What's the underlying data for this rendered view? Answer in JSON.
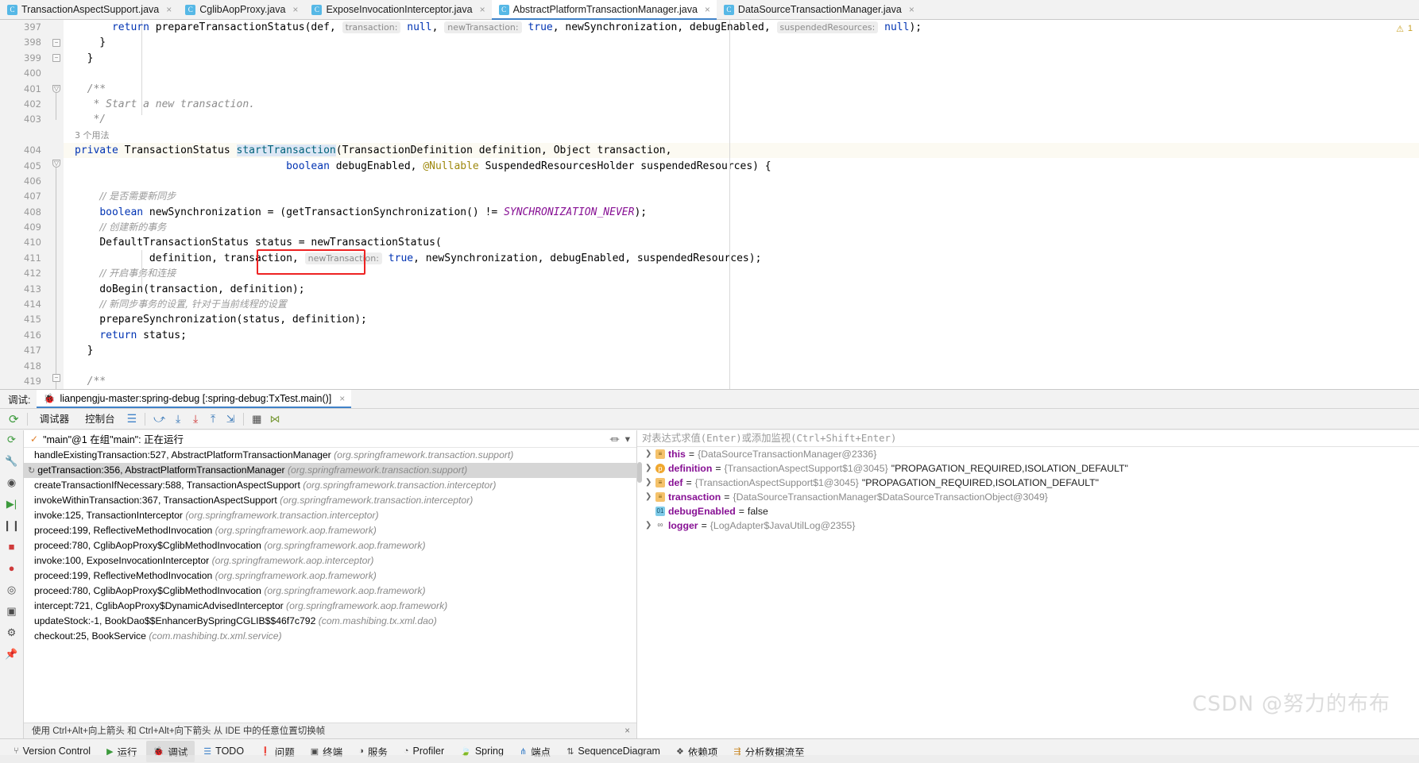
{
  "editor_tabs": [
    {
      "label": "TransactionAspectSupport.java",
      "icon": "java-class-icon",
      "active": false,
      "closable": true
    },
    {
      "label": "CglibAopProxy.java",
      "icon": "java-class-icon",
      "active": false,
      "closable": true
    },
    {
      "label": "ExposeInvocationInterceptor.java",
      "icon": "java-class-icon",
      "active": false,
      "closable": true
    },
    {
      "label": "AbstractPlatformTransactionManager.java",
      "icon": "java-class-icon",
      "active": true,
      "closable": true
    },
    {
      "label": "DataSourceTransactionManager.java",
      "icon": "java-class-icon",
      "active": false,
      "closable": true
    }
  ],
  "editor": {
    "line_numbers": [
      "397",
      "398",
      "399",
      "400",
      "401",
      "402",
      "403",
      "404",
      "405",
      "406",
      "407",
      "408",
      "409",
      "410",
      "411",
      "412",
      "413",
      "414",
      "415",
      "416",
      "417",
      "418",
      "419"
    ],
    "usage_hint": "3 个用法",
    "warning_marker": "1",
    "code_lines": [
      {
        "n": "397",
        "text": "            return prepareTransactionStatus(def,  transaction: null,  newTransaction: true, newSynchronization, debugEnabled,  suspendedResources: null);"
      },
      {
        "n": "398",
        "text": "        }"
      },
      {
        "n": "399",
        "text": "    }"
      },
      {
        "n": "400",
        "text": ""
      },
      {
        "n": "401",
        "text": "    /**"
      },
      {
        "n": "402",
        "text": "     * Start a new transaction."
      },
      {
        "n": "403",
        "text": "     */"
      },
      {
        "n": "404",
        "text": "    private TransactionStatus startTransaction(TransactionDefinition definition, Object transaction,"
      },
      {
        "n": "405",
        "text": "            boolean debugEnabled, @Nullable SuspendedResourcesHolder suspendedResources) {"
      },
      {
        "n": "406",
        "text": ""
      },
      {
        "n": "407",
        "text": "        // 是否需要新同步"
      },
      {
        "n": "408",
        "text": "        boolean newSynchronization = (getTransactionSynchronization() != SYNCHRONIZATION_NEVER);"
      },
      {
        "n": "409",
        "text": "        // 创建新的事务"
      },
      {
        "n": "410",
        "text": "        DefaultTransactionStatus status = newTransactionStatus("
      },
      {
        "n": "411",
        "text": "                definition, transaction,  newTransaction: true, newSynchronization, debugEnabled, suspendedResources);"
      },
      {
        "n": "412",
        "text": "        // 开启事务和连接"
      },
      {
        "n": "413",
        "text": "        doBegin(transaction, definition);"
      },
      {
        "n": "414",
        "text": "        // 新同步事务的设置, 针对于当前线程的设置"
      },
      {
        "n": "415",
        "text": "        prepareSynchronization(status, definition);"
      },
      {
        "n": "416",
        "text": "        return status;"
      },
      {
        "n": "417",
        "text": "    }"
      },
      {
        "n": "418",
        "text": ""
      },
      {
        "n": "419",
        "text": "    /**"
      }
    ],
    "tokens": {
      "kw_return": "return",
      "kw_private": "private",
      "kw_boolean": "boolean",
      "method_prepareTransactionStatus": "prepareTransactionStatus",
      "method_startTransaction": "startTransaction",
      "type_TransactionStatus": "TransactionStatus",
      "type_TransactionDefinition": "TransactionDefinition",
      "type_Object": "Object",
      "type_SuspendedResourcesHolder": "SuspendedResourcesHolder",
      "type_DefaultTransactionStatus": "DefaultTransactionStatus",
      "annotation_Nullable": "@Nullable",
      "const_SYNCHRONIZATION_NEVER": "SYNCHRONIZATION_NEVER",
      "hint_transaction": "transaction:",
      "hint_newTransaction": "newTransaction:",
      "hint_suspendedResources": "suspendedResources:",
      "val_null": "null",
      "val_true": "true",
      "comment_javadoc_open": "/**",
      "comment_javadoc_body": "* Start a new transaction.",
      "comment_javadoc_close": "*/",
      "comment_cn_1": "// 是否需要新同步",
      "comment_cn_2": "// 创建新的事务",
      "comment_cn_3": "// 开启事务和连接",
      "comment_cn_4": "// 新同步事务的设置, 针对于当前线程的设置"
    }
  },
  "debug": {
    "header_label": "调试:",
    "session_name": "lianpengju-master:spring-debug [:spring-debug:TxTest.main()]",
    "session_close": "×",
    "tabs": [
      {
        "label": "调试器",
        "active": true
      },
      {
        "label": "控制台",
        "active": false
      }
    ],
    "toolbar_icons": [
      {
        "name": "rerun-icon",
        "glyph": "⟳"
      },
      {
        "name": "layout-icon",
        "glyph": "☰"
      },
      {
        "name": "step-over-icon",
        "glyph": "⤻"
      },
      {
        "name": "step-into-icon",
        "glyph": "↓"
      },
      {
        "name": "force-step-into-icon",
        "glyph": "↓"
      },
      {
        "name": "step-out-icon",
        "glyph": "↑"
      },
      {
        "name": "run-to-cursor-icon",
        "glyph": "⇲"
      },
      {
        "name": "evaluate-expression-icon",
        "glyph": "▦"
      },
      {
        "name": "mute-breakpoints-icon",
        "glyph": "⋈"
      }
    ],
    "rail_icons": [
      {
        "name": "rerun-debug-icon",
        "glyph": "⟳"
      },
      {
        "name": "settings-wrench-icon",
        "glyph": "🔧"
      },
      {
        "name": "mute-breakpoints-eye-icon",
        "glyph": "◉"
      },
      {
        "name": "resume-program-icon",
        "glyph": "▶|"
      },
      {
        "name": "pause-program-icon",
        "glyph": "❙❙"
      },
      {
        "name": "stop-icon",
        "glyph": "■"
      },
      {
        "name": "view-breakpoints-icon",
        "glyph": "●"
      },
      {
        "name": "mute-icon",
        "glyph": "◎"
      },
      {
        "name": "screenshot-icon",
        "glyph": "▣"
      },
      {
        "name": "settings-gear-icon",
        "glyph": "⚙"
      },
      {
        "name": "pin-icon",
        "glyph": "📌"
      }
    ],
    "thread": {
      "status_icon": "✓",
      "label": "\"main\"@1 在组\"main\": 正在运行",
      "filter_icon": "filter-icon",
      "dropdown_icon": "chevron-down-icon"
    },
    "frames": [
      {
        "method": "handleExistingTransaction:527, AbstractPlatformTransactionManager",
        "pkg": "(org.springframework.transaction.support)",
        "selected": false
      },
      {
        "method": "getTransaction:356, AbstractPlatformTransactionManager",
        "pkg": "(org.springframework.transaction.support)",
        "selected": true
      },
      {
        "method": "createTransactionIfNecessary:588, TransactionAspectSupport",
        "pkg": "(org.springframework.transaction.interceptor)",
        "selected": false
      },
      {
        "method": "invokeWithinTransaction:367, TransactionAspectSupport",
        "pkg": "(org.springframework.transaction.interceptor)",
        "selected": false
      },
      {
        "method": "invoke:125, TransactionInterceptor",
        "pkg": "(org.springframework.transaction.interceptor)",
        "selected": false
      },
      {
        "method": "proceed:199, ReflectiveMethodInvocation",
        "pkg": "(org.springframework.aop.framework)",
        "selected": false
      },
      {
        "method": "proceed:780, CglibAopProxy$CglibMethodInvocation",
        "pkg": "(org.springframework.aop.framework)",
        "selected": false
      },
      {
        "method": "invoke:100, ExposeInvocationInterceptor",
        "pkg": "(org.springframework.aop.interceptor)",
        "selected": false
      },
      {
        "method": "proceed:199, ReflectiveMethodInvocation",
        "pkg": "(org.springframework.aop.framework)",
        "selected": false
      },
      {
        "method": "proceed:780, CglibAopProxy$CglibMethodInvocation",
        "pkg": "(org.springframework.aop.framework)",
        "selected": false
      },
      {
        "method": "intercept:721, CglibAopProxy$DynamicAdvisedInterceptor",
        "pkg": "(org.springframework.aop.framework)",
        "selected": false
      },
      {
        "method": "updateStock:-1, BookDao$$EnhancerBySpringCGLIB$$46f7c792",
        "pkg": "(com.mashibing.tx.xml.dao)",
        "selected": false
      },
      {
        "method": "checkout:25, BookService",
        "pkg": "(com.mashibing.tx.xml.service)",
        "selected": false
      }
    ],
    "frames_hint": "使用 Ctrl+Alt+向上箭头 和 Ctrl+Alt+向下箭头 从 IDE 中的任意位置切换帧",
    "frames_hint_close": "×",
    "watch_placeholder": "对表达式求值(Enter)或添加监视(Ctrl+Shift+Enter)",
    "variables": [
      {
        "expandable": true,
        "icon_kind": "obj",
        "icon_glyph": "≡",
        "name": "this",
        "value": "{DataSourceTransactionManager@2336}",
        "value_str": ""
      },
      {
        "expandable": true,
        "icon_kind": "param",
        "icon_glyph": "p",
        "name": "definition",
        "value": "{TransactionAspectSupport$1@3045}",
        "value_str": "\"PROPAGATION_REQUIRED,ISOLATION_DEFAULT\""
      },
      {
        "expandable": true,
        "icon_kind": "obj",
        "icon_glyph": "≡",
        "name": "def",
        "value": "{TransactionAspectSupport$1@3045}",
        "value_str": "\"PROPAGATION_REQUIRED,ISOLATION_DEFAULT\""
      },
      {
        "expandable": true,
        "icon_kind": "obj",
        "icon_glyph": "≡",
        "name": "transaction",
        "value": "{DataSourceTransactionManager$DataSourceTransactionObject@3049}",
        "value_str": ""
      },
      {
        "expandable": false,
        "icon_kind": "bool",
        "icon_glyph": "01",
        "name": "debugEnabled",
        "value": "false",
        "value_str": "",
        "value_plain": true
      },
      {
        "expandable": true,
        "icon_kind": "field",
        "icon_glyph": "∞",
        "name": "logger",
        "value": "{LogAdapter$JavaUtilLog@2355}",
        "value_str": ""
      }
    ]
  },
  "statusbar": [
    {
      "label": "Version Control",
      "icon": "branch-icon",
      "glyph": "⑂",
      "active": false
    },
    {
      "label": "运行",
      "icon": "run-icon",
      "glyph": "▶",
      "active": false
    },
    {
      "label": "调试",
      "icon": "debug-bug-icon",
      "glyph": "🐞",
      "active": true
    },
    {
      "label": "TODO",
      "icon": "todo-list-icon",
      "glyph": "☰",
      "active": false
    },
    {
      "label": "问题",
      "icon": "problems-icon",
      "glyph": "❗",
      "active": false
    },
    {
      "label": "终端",
      "icon": "terminal-icon",
      "glyph": "▣",
      "active": false
    },
    {
      "label": "服务",
      "icon": "services-icon",
      "glyph": "◑",
      "active": false
    },
    {
      "label": "Profiler",
      "icon": "profiler-icon",
      "glyph": "◔",
      "active": false
    },
    {
      "label": "Spring",
      "icon": "spring-leaf-icon",
      "glyph": "🍃",
      "active": false
    },
    {
      "label": "端点",
      "icon": "endpoints-icon",
      "glyph": "⋔",
      "active": false
    },
    {
      "label": "SequenceDiagram",
      "icon": "sequence-diagram-icon",
      "glyph": "⇅",
      "active": false
    },
    {
      "label": "依赖项",
      "icon": "dependencies-icon",
      "glyph": "❖",
      "active": false
    },
    {
      "label": "分析数据流至",
      "icon": "dataflow-icon",
      "glyph": "⇶",
      "active": false
    }
  ],
  "watermark": "CSDN @努力的布布",
  "colors": {
    "accent": "#4083c9",
    "annotation_box": "#ee2222",
    "keyword": "#0033b3",
    "comment": "#8c8c8c",
    "selection": "#d6d6d6",
    "variable_name": "#871094"
  }
}
